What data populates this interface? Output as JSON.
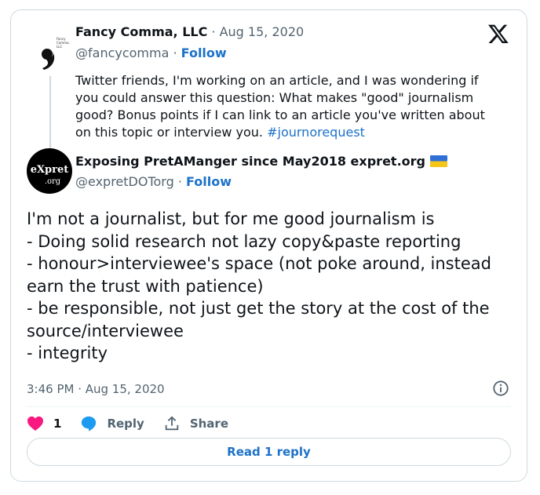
{
  "quoted": {
    "author_name": "Fancy Comma, LLC",
    "date": "Aug 15, 2020",
    "handle": "@fancycomma",
    "follow_label": "Follow",
    "text": "Twitter friends, I'm working on an article, and I was wondering if you could answer this question: What makes \"good\" journalism good? Bonus points if I can link to an article you've written about on this topic or interview you.",
    "hashtag": "#journorequest",
    "avatar_text": "Fancy Comma, LLC"
  },
  "reply": {
    "author_name": "Exposing PretAManger since May2018 expret.org",
    "handle": "@expretDOTorg",
    "follow_label": "Follow",
    "avatar_text_top": "eXpret",
    "avatar_text_bottom": ".org",
    "lines": [
      "I'm not a journalist, but for me good journalism is",
      "- Doing solid research not lazy copy&paste reporting",
      "- honour>interviewee's space (not poke around, instead",
      "earn the trust with patience)",
      "- be responsible, not just get the story at the cost of the",
      "source/interviewee",
      "- integrity"
    ],
    "timestamp": "3:46 PM · Aug 15, 2020"
  },
  "actions": {
    "like_count": "1",
    "reply_label": "Reply",
    "share_label": "Share"
  },
  "read_reply_label": "Read 1 reply",
  "colors": {
    "link": "#1d72c9",
    "like": "#f91880",
    "muted": "#536471",
    "border": "#cfd9de"
  },
  "icons": [
    "x-logo-icon",
    "info-icon",
    "heart-icon",
    "reply-bubble-icon",
    "share-icon",
    "ukraine-flag-icon"
  ]
}
